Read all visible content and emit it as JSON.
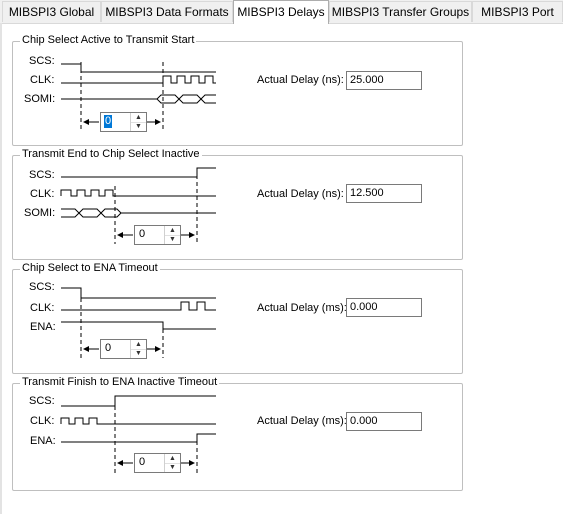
{
  "tabs": [
    {
      "label": "MIBSPI3 Global",
      "active": false
    },
    {
      "label": "MIBSPI3 Data Formats",
      "active": false
    },
    {
      "label": "MIBSPI3 Delays",
      "active": true
    },
    {
      "label": "MIBSPI3 Transfer Groups",
      "active": false
    },
    {
      "label": "MIBSPI3 Port",
      "active": false
    }
  ],
  "groups": [
    {
      "title": "Chip Select Active to Transmit Start",
      "signals": [
        "SCS:",
        "CLK:",
        "SOMI:"
      ],
      "delay_label": "Actual Delay (ns):",
      "delay_value": "25.000",
      "spinner_value": "0",
      "spinner_selected": true
    },
    {
      "title": "Transmit End to Chip Select Inactive",
      "signals": [
        "SCS:",
        "CLK:",
        "SOMI:"
      ],
      "delay_label": "Actual Delay (ns):",
      "delay_value": "12.500",
      "spinner_value": "0",
      "spinner_selected": false
    },
    {
      "title": "Chip Select to ENA Timeout",
      "signals": [
        "SCS:",
        "CLK:",
        "ENA:"
      ],
      "delay_label": "Actual Delay (ms):",
      "delay_value": "0.000",
      "spinner_value": "0",
      "spinner_selected": false
    },
    {
      "title": "Transmit Finish to ENA Inactive Timeout",
      "signals": [
        "SCS:",
        "CLK:",
        "ENA:"
      ],
      "delay_label": "Actual Delay (ms):",
      "delay_value": "0.000",
      "spinner_value": "0",
      "spinner_selected": false
    }
  ],
  "icons": {
    "spin_up": "spin-up-icon",
    "spin_down": "spin-down-icon"
  },
  "colors": {
    "selection": "#0078d7",
    "group_border": "#bfbfbf",
    "tab_bg": "#f0f0f0"
  }
}
